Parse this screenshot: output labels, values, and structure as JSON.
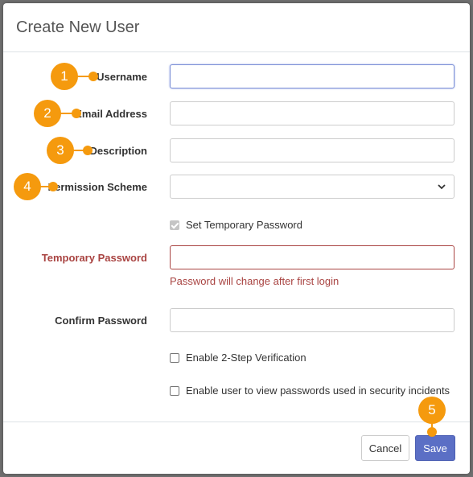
{
  "dialog": {
    "title": "Create New User"
  },
  "fields": {
    "username": {
      "label": "Username",
      "value": ""
    },
    "email": {
      "label": "Email Address",
      "value": ""
    },
    "description": {
      "label": "Description",
      "value": ""
    },
    "permission_scheme": {
      "label": "Permission Scheme",
      "selected": ""
    },
    "set_temp_password": {
      "label": "Set Temporary Password",
      "checked": true,
      "disabled": true
    },
    "temporary_password": {
      "label": "Temporary Password",
      "value": "",
      "help": "Password will change after first login"
    },
    "confirm_password": {
      "label": "Confirm Password",
      "value": ""
    },
    "two_step": {
      "label": "Enable 2-Step Verification",
      "checked": false
    },
    "view_passwords": {
      "label": "Enable user to view passwords used in security incidents",
      "checked": false
    }
  },
  "footer": {
    "cancel_label": "Cancel",
    "save_label": "Save"
  },
  "callouts": [
    "1",
    "2",
    "3",
    "4",
    "5"
  ],
  "colors": {
    "callout": "#f59a0e",
    "primary": "#5b6fc5",
    "error": "#a94442"
  },
  "icons": {
    "select_indicator": "chevron-down-icon"
  }
}
